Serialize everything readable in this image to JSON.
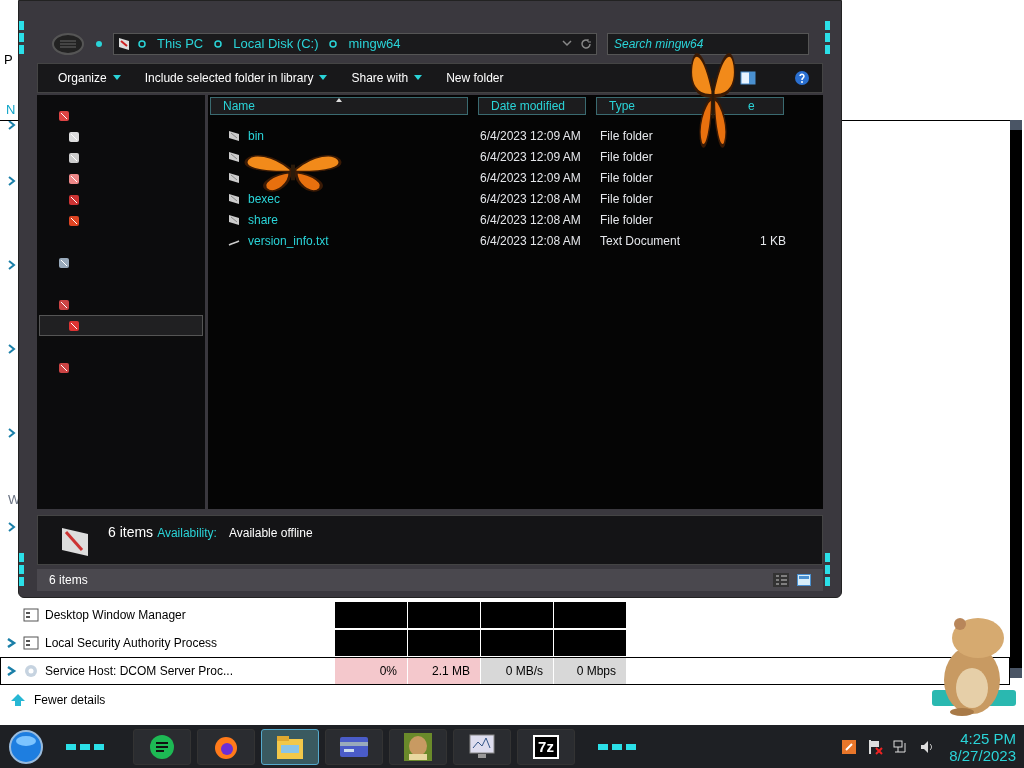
{
  "background_window": {
    "cut_texts": [
      {
        "text": "P"
      },
      {
        "text": "N"
      },
      {
        "text": "W"
      }
    ],
    "processes": [
      {
        "name": "Desktop Window Manager",
        "expandable": false,
        "selected": false
      },
      {
        "name": "Local Security Authority Process",
        "expandable": true,
        "selected": false
      },
      {
        "name": "Service Host: DCOM Server Proc...",
        "expandable": true,
        "selected": true,
        "cpu": "0%",
        "memory": "2.1 MB",
        "disk": "0 MB/s",
        "network": "0 Mbps"
      }
    ],
    "fewer_details": "Fewer details"
  },
  "explorer": {
    "breadcrumb": [
      "This PC",
      "Local Disk (C:)",
      "mingw64"
    ],
    "search": {
      "placeholder": "Search mingw64"
    },
    "toolbar": [
      {
        "label": "Organize",
        "dropdown": true
      },
      {
        "label": "Include selected folder in library",
        "dropdown": true
      },
      {
        "label": "Share with",
        "dropdown": true
      },
      {
        "label": "New folder",
        "dropdown": false
      }
    ],
    "nav_pane": {
      "items": [
        {
          "selected": false,
          "children": [
            {
              "selected": false
            },
            {
              "selected": false
            },
            {
              "selected": false
            },
            {
              "selected": false
            },
            {
              "selected": false
            }
          ]
        },
        {
          "selected": false
        },
        {
          "selected": false,
          "children": [
            {
              "selected": true
            }
          ]
        },
        {
          "selected": false
        }
      ]
    },
    "columns": [
      {
        "label": "Name",
        "sorted": true
      },
      {
        "label": "Date modified",
        "sorted": false
      },
      {
        "label": "Type",
        "sorted": false
      },
      {
        "label": "e",
        "sorted": false
      }
    ],
    "files": [
      {
        "kind": "folder",
        "name": "bin",
        "date": "6/4/2023 12:09 AM",
        "type": "File folder"
      },
      {
        "kind": "folder",
        "date": "6/4/2023 12:09 AM",
        "type": "File folder"
      },
      {
        "kind": "folder",
        "date": "6/4/2023 12:09 AM",
        "type": "File folder"
      },
      {
        "kind": "folder",
        "name": "bexec",
        "date": "6/4/2023 12:08 AM",
        "type": "File folder"
      },
      {
        "kind": "folder",
        "name": "share",
        "date": "6/4/2023 12:08 AM",
        "type": "File folder"
      },
      {
        "kind": "file",
        "name": "version_info.txt",
        "date": "6/4/2023 12:08 AM",
        "type": "Text Document",
        "size": "1 KB"
      }
    ],
    "details": {
      "count": "6 items",
      "availability_label": "Availability:",
      "availability": "Available offline"
    },
    "status_bar": {
      "count": "6 items"
    }
  },
  "taskbar": {
    "apps": [
      {
        "kind": "chat",
        "selected": false
      },
      {
        "kind": "browser",
        "selected": false
      },
      {
        "kind": "folder",
        "selected": true
      },
      {
        "kind": "card",
        "selected": false
      },
      {
        "kind": "box",
        "selected": false
      },
      {
        "kind": "monitor",
        "selected": false
      },
      {
        "kind": "archive",
        "selected": false,
        "label": "7z"
      }
    ],
    "clock": {
      "time": "4:25 PM",
      "date": "8/27/2023"
    }
  }
}
